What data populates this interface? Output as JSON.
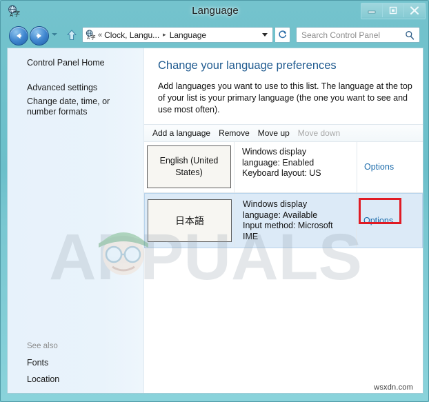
{
  "window": {
    "title": "Language",
    "app_icon": "language-icon",
    "controls": {
      "minimize": "minimize-icon",
      "maximize": "maximize-icon",
      "close": "close-icon"
    }
  },
  "navbar": {
    "back": "back-arrow-icon",
    "forward": "forward-arrow-icon",
    "history": "history-dropdown-icon",
    "up": "up-arrow-icon",
    "address": {
      "icon": "language-icon",
      "chevrons": "«",
      "crumbs": [
        "Clock, Langu...",
        "Language"
      ],
      "separator": "▸",
      "dropdown": "chevron-down-icon"
    },
    "refresh": "refresh-icon",
    "search": {
      "placeholder": "Search Control Panel",
      "icon": "search-icon"
    }
  },
  "sidebar": {
    "control_panel_home": "Control Panel Home",
    "advanced_settings": "Advanced settings",
    "change_date": "Change date, time, or number formats",
    "see_also_label": "See also",
    "fonts": "Fonts",
    "location": "Location"
  },
  "main": {
    "heading": "Change your language preferences",
    "description": "Add languages you want to use to this list. The language at the top of your list is your primary language (the one you want to see and use most often).",
    "commands": [
      {
        "label": "Add a language",
        "enabled": true
      },
      {
        "label": "Remove",
        "enabled": true
      },
      {
        "label": "Move up",
        "enabled": true
      },
      {
        "label": "Move down",
        "enabled": false
      }
    ],
    "languages": [
      {
        "name": "English (United States)",
        "info": "Windows display language: Enabled\nKeyboard layout: US",
        "info_line1": "Windows display",
        "info_line2": "language: Enabled",
        "info_line3": "Keyboard layout: US",
        "options_label": "Options",
        "selected": false,
        "highlighted": false
      },
      {
        "name": "日本語",
        "info": "Windows display language: Available\nInput method: Microsoft IME",
        "info_line1": "Windows display",
        "info_line2": "language: Available",
        "info_line3": "Input method: Microsoft",
        "info_line4": "IME",
        "options_label": "Options",
        "selected": true,
        "highlighted": true
      }
    ]
  },
  "watermarks": {
    "appuals": "APPUALS",
    "site": "wsxdn.com"
  },
  "colors": {
    "titlebar": "#6bbfca",
    "heading": "#1f5a8f",
    "link": "#1a6aaa",
    "selection": "#dceaf7",
    "highlight_box": "#e01b24"
  }
}
